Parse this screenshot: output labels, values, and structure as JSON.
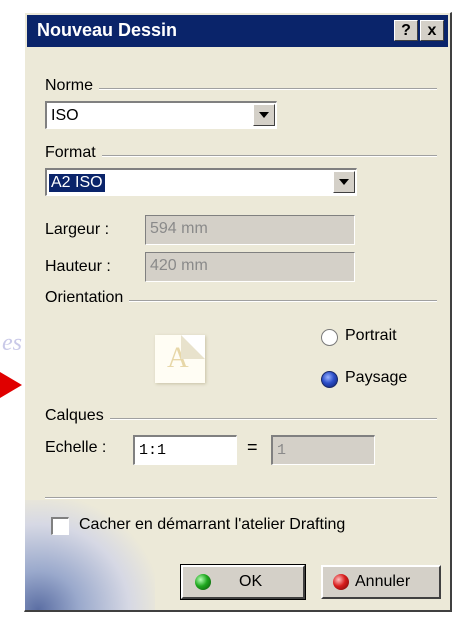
{
  "window": {
    "title": "Nouveau Dessin",
    "help_label": "?",
    "close_label": "x"
  },
  "norme": {
    "label": "Norme",
    "value": "ISO"
  },
  "format": {
    "label": "Format",
    "value": "A2 ISO",
    "largeur_label": "Largeur :",
    "largeur_value": "594 mm",
    "hauteur_label": "Hauteur :",
    "hauteur_value": "420 mm"
  },
  "orientation": {
    "label": "Orientation",
    "icon_letter": "A",
    "portrait_label": "Portrait",
    "paysage_label": "Paysage",
    "selected": "Paysage"
  },
  "calques": {
    "label": "Calques",
    "echelle_label": "Echelle :",
    "echelle_value": "1:1",
    "equals": "=",
    "result_value": "1"
  },
  "options": {
    "hide_checkbox_label": "Cacher en démarrant l'atelier Drafting",
    "hide_checked": false
  },
  "buttons": {
    "ok_label": "OK",
    "cancel_label": "Annuler"
  }
}
